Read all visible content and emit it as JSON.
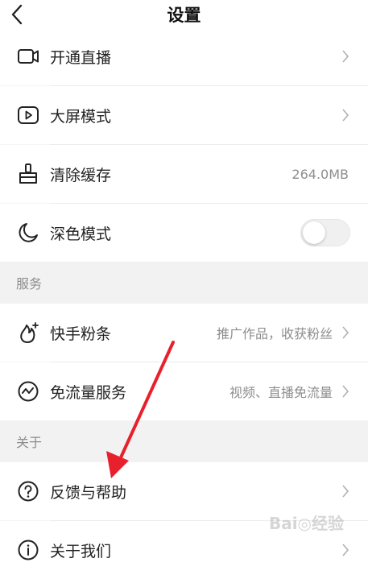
{
  "header": {
    "title": "设置"
  },
  "rows": {
    "live": {
      "label": "开通直播"
    },
    "bigscreen": {
      "label": "大屏模式"
    },
    "cache": {
      "label": "清除缓存",
      "value": "264.0MB"
    },
    "dark": {
      "label": "深色模式",
      "toggle_on": false
    }
  },
  "sections": {
    "service": "服务",
    "about": "关于"
  },
  "service_rows": {
    "fans": {
      "label": "快手粉条",
      "value": "推广作品，收获粉丝"
    },
    "traffic": {
      "label": "免流量服务",
      "value": "视频、直播免流量"
    }
  },
  "about_rows": {
    "feedback": {
      "label": "反馈与帮助"
    },
    "aboutus": {
      "label": "关于我们"
    }
  },
  "colors": {
    "annotation_arrow": "#e8202c"
  }
}
